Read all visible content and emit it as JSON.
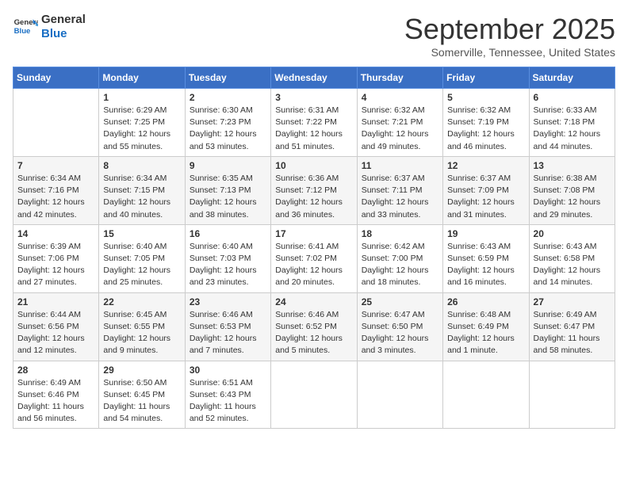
{
  "header": {
    "logo_line1": "General",
    "logo_line2": "Blue",
    "month": "September 2025",
    "location": "Somerville, Tennessee, United States"
  },
  "days_of_week": [
    "Sunday",
    "Monday",
    "Tuesday",
    "Wednesday",
    "Thursday",
    "Friday",
    "Saturday"
  ],
  "weeks": [
    [
      {
        "day": "",
        "info": ""
      },
      {
        "day": "1",
        "info": "Sunrise: 6:29 AM\nSunset: 7:25 PM\nDaylight: 12 hours\nand 55 minutes."
      },
      {
        "day": "2",
        "info": "Sunrise: 6:30 AM\nSunset: 7:23 PM\nDaylight: 12 hours\nand 53 minutes."
      },
      {
        "day": "3",
        "info": "Sunrise: 6:31 AM\nSunset: 7:22 PM\nDaylight: 12 hours\nand 51 minutes."
      },
      {
        "day": "4",
        "info": "Sunrise: 6:32 AM\nSunset: 7:21 PM\nDaylight: 12 hours\nand 49 minutes."
      },
      {
        "day": "5",
        "info": "Sunrise: 6:32 AM\nSunset: 7:19 PM\nDaylight: 12 hours\nand 46 minutes."
      },
      {
        "day": "6",
        "info": "Sunrise: 6:33 AM\nSunset: 7:18 PM\nDaylight: 12 hours\nand 44 minutes."
      }
    ],
    [
      {
        "day": "7",
        "info": "Sunrise: 6:34 AM\nSunset: 7:16 PM\nDaylight: 12 hours\nand 42 minutes."
      },
      {
        "day": "8",
        "info": "Sunrise: 6:34 AM\nSunset: 7:15 PM\nDaylight: 12 hours\nand 40 minutes."
      },
      {
        "day": "9",
        "info": "Sunrise: 6:35 AM\nSunset: 7:13 PM\nDaylight: 12 hours\nand 38 minutes."
      },
      {
        "day": "10",
        "info": "Sunrise: 6:36 AM\nSunset: 7:12 PM\nDaylight: 12 hours\nand 36 minutes."
      },
      {
        "day": "11",
        "info": "Sunrise: 6:37 AM\nSunset: 7:11 PM\nDaylight: 12 hours\nand 33 minutes."
      },
      {
        "day": "12",
        "info": "Sunrise: 6:37 AM\nSunset: 7:09 PM\nDaylight: 12 hours\nand 31 minutes."
      },
      {
        "day": "13",
        "info": "Sunrise: 6:38 AM\nSunset: 7:08 PM\nDaylight: 12 hours\nand 29 minutes."
      }
    ],
    [
      {
        "day": "14",
        "info": "Sunrise: 6:39 AM\nSunset: 7:06 PM\nDaylight: 12 hours\nand 27 minutes."
      },
      {
        "day": "15",
        "info": "Sunrise: 6:40 AM\nSunset: 7:05 PM\nDaylight: 12 hours\nand 25 minutes."
      },
      {
        "day": "16",
        "info": "Sunrise: 6:40 AM\nSunset: 7:03 PM\nDaylight: 12 hours\nand 23 minutes."
      },
      {
        "day": "17",
        "info": "Sunrise: 6:41 AM\nSunset: 7:02 PM\nDaylight: 12 hours\nand 20 minutes."
      },
      {
        "day": "18",
        "info": "Sunrise: 6:42 AM\nSunset: 7:00 PM\nDaylight: 12 hours\nand 18 minutes."
      },
      {
        "day": "19",
        "info": "Sunrise: 6:43 AM\nSunset: 6:59 PM\nDaylight: 12 hours\nand 16 minutes."
      },
      {
        "day": "20",
        "info": "Sunrise: 6:43 AM\nSunset: 6:58 PM\nDaylight: 12 hours\nand 14 minutes."
      }
    ],
    [
      {
        "day": "21",
        "info": "Sunrise: 6:44 AM\nSunset: 6:56 PM\nDaylight: 12 hours\nand 12 minutes."
      },
      {
        "day": "22",
        "info": "Sunrise: 6:45 AM\nSunset: 6:55 PM\nDaylight: 12 hours\nand 9 minutes."
      },
      {
        "day": "23",
        "info": "Sunrise: 6:46 AM\nSunset: 6:53 PM\nDaylight: 12 hours\nand 7 minutes."
      },
      {
        "day": "24",
        "info": "Sunrise: 6:46 AM\nSunset: 6:52 PM\nDaylight: 12 hours\nand 5 minutes."
      },
      {
        "day": "25",
        "info": "Sunrise: 6:47 AM\nSunset: 6:50 PM\nDaylight: 12 hours\nand 3 minutes."
      },
      {
        "day": "26",
        "info": "Sunrise: 6:48 AM\nSunset: 6:49 PM\nDaylight: 12 hours\nand 1 minute."
      },
      {
        "day": "27",
        "info": "Sunrise: 6:49 AM\nSunset: 6:47 PM\nDaylight: 11 hours\nand 58 minutes."
      }
    ],
    [
      {
        "day": "28",
        "info": "Sunrise: 6:49 AM\nSunset: 6:46 PM\nDaylight: 11 hours\nand 56 minutes."
      },
      {
        "day": "29",
        "info": "Sunrise: 6:50 AM\nSunset: 6:45 PM\nDaylight: 11 hours\nand 54 minutes."
      },
      {
        "day": "30",
        "info": "Sunrise: 6:51 AM\nSunset: 6:43 PM\nDaylight: 11 hours\nand 52 minutes."
      },
      {
        "day": "",
        "info": ""
      },
      {
        "day": "",
        "info": ""
      },
      {
        "day": "",
        "info": ""
      },
      {
        "day": "",
        "info": ""
      }
    ]
  ]
}
